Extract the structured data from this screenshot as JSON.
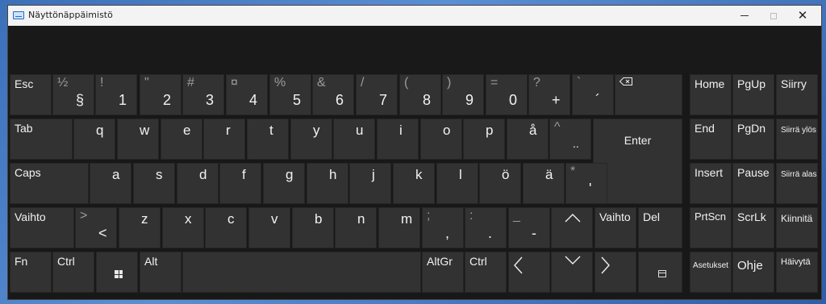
{
  "window": {
    "title": "Näyttönäppäimistö"
  },
  "keys": {
    "esc": "Esc",
    "tab": "Tab",
    "caps": "Caps",
    "shift_left": "Vaihto",
    "fn": "Fn",
    "ctrl_left": "Ctrl",
    "alt": "Alt",
    "altgr": "AltGr",
    "ctrl_right": "Ctrl",
    "enter": "Enter",
    "shift_right": "Vaihto",
    "del": "Del",
    "home": "Home",
    "pgup": "PgUp",
    "siirry": "Siirry",
    "end": "End",
    "pgdn": "PgDn",
    "siirra_ylos": "Siirrä ylös",
    "insert": "Insert",
    "pause": "Pause",
    "siirra_alas": "Siirrä alas",
    "prtscn": "PrtScn",
    "scrlk": "ScrLk",
    "kiinnita": "Kiinnitä",
    "asetukset": "Asetukset",
    "ohje": "Ohje",
    "haivyta": "Häivytä"
  },
  "number_row": [
    {
      "shift": "½",
      "main": "§"
    },
    {
      "shift": "!",
      "main": "1"
    },
    {
      "shift": "\"",
      "main": "2"
    },
    {
      "shift": "#",
      "main": "3"
    },
    {
      "shift": "¤",
      "main": "4"
    },
    {
      "shift": "%",
      "main": "5"
    },
    {
      "shift": "&",
      "main": "6"
    },
    {
      "shift": "/",
      "main": "7"
    },
    {
      "shift": "(",
      "main": "8"
    },
    {
      "shift": ")",
      "main": "9"
    },
    {
      "shift": "=",
      "main": "0"
    },
    {
      "shift": "?",
      "main": "+"
    },
    {
      "shift": "`",
      "main": "´"
    }
  ],
  "row_q": [
    "q",
    "w",
    "e",
    "r",
    "t",
    "y",
    "u",
    "i",
    "o",
    "p",
    "å"
  ],
  "row_q_extra": {
    "shift": "^",
    "main": ".."
  },
  "row_a": [
    "a",
    "s",
    "d",
    "f",
    "g",
    "h",
    "j",
    "k",
    "l",
    "ö",
    "ä"
  ],
  "row_a_extra": {
    "shift": "*",
    "main": "'"
  },
  "row_z_lt": {
    "shift": ">",
    "main": "<"
  },
  "row_z": [
    "z",
    "x",
    "c",
    "v",
    "b",
    "n",
    "m"
  ],
  "row_z_punct": [
    {
      "shift": ";",
      "main": ","
    },
    {
      "shift": ":",
      "main": "."
    },
    {
      "shift": "_",
      "main": "-"
    }
  ],
  "arrows": {
    "up": "^",
    "left": "<",
    "down": "v",
    "right": ">"
  }
}
